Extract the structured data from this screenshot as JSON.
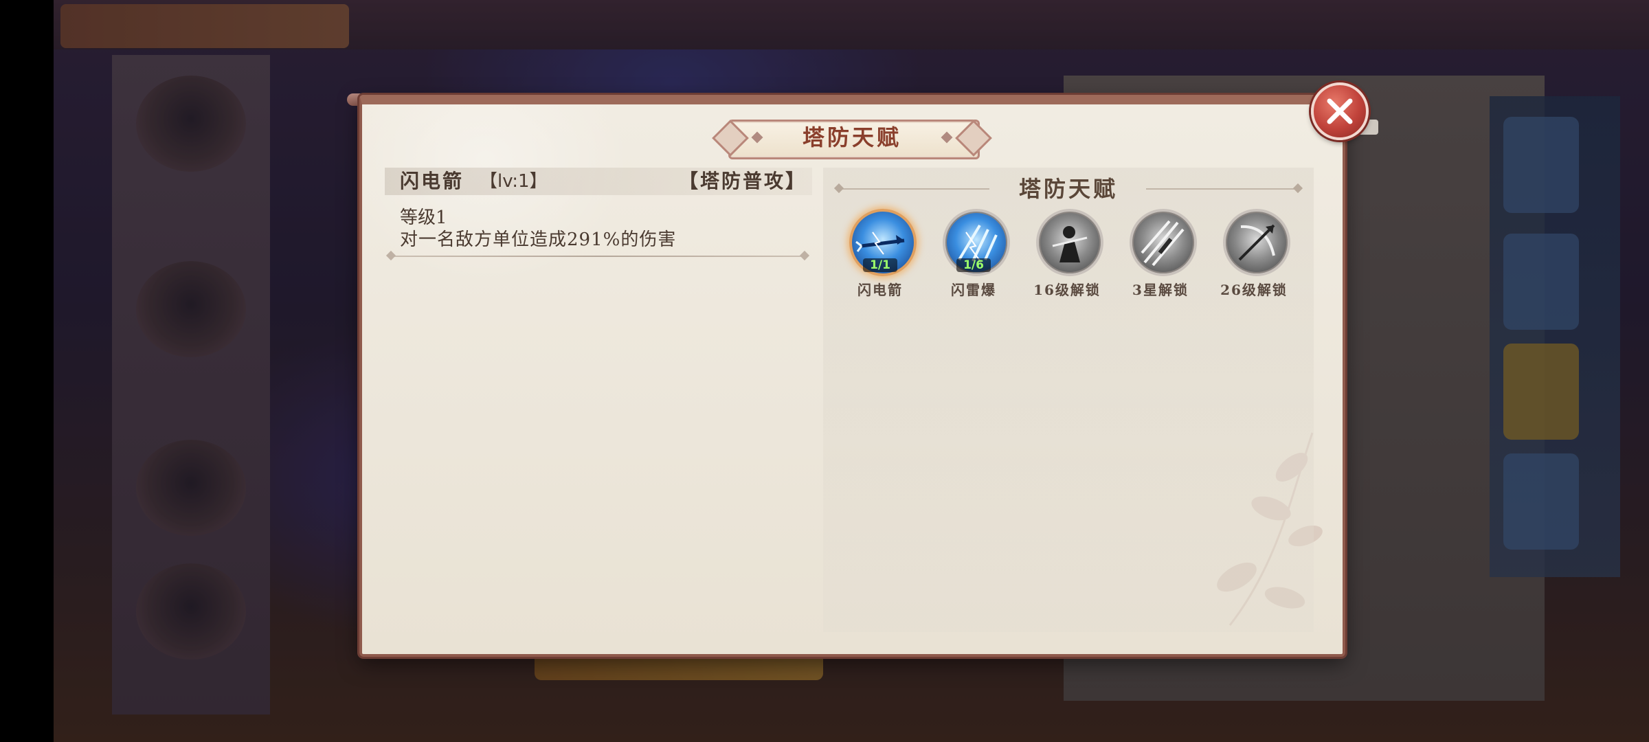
{
  "dialog": {
    "title": "塔防天赋",
    "close_icon": "close-x-icon"
  },
  "skill": {
    "name": "闪电箭",
    "level_tag": "【lv:1】",
    "type_tag": "【塔防普攻】",
    "grade": "等级1",
    "description": "对一名敌方单位造成291%的伤害"
  },
  "talent_panel": {
    "title": "塔防天赋",
    "items": [
      {
        "label": "闪电箭",
        "count": "1/1",
        "icon": "lightning-arrow-icon",
        "state": "selected"
      },
      {
        "label": "闪雷爆",
        "count": "1/6",
        "icon": "thunder-burst-icon",
        "state": "unlocked"
      },
      {
        "label": "16级解锁",
        "icon": "warrior-silhouette-icon",
        "state": "locked"
      },
      {
        "label": "3星解锁",
        "icon": "slash-streak-icon",
        "state": "locked"
      },
      {
        "label": "26级解锁",
        "icon": "crossbow-icon",
        "state": "locked"
      }
    ]
  },
  "colors": {
    "accent_title": "#8a3f2c",
    "frame": "#8f5a4c",
    "count_green": "#9cff6a"
  }
}
